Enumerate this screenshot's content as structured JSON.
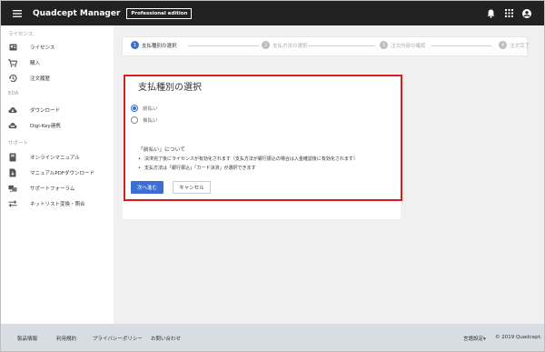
{
  "header": {
    "title": "Quadcept Manager",
    "edition": "Professional edition",
    "icons": [
      "menu-icon",
      "bell-icon",
      "apps-icon",
      "account-icon"
    ]
  },
  "sidebar": {
    "sections": [
      {
        "title": "ライセンス"
      },
      {
        "title": "EDA"
      },
      {
        "title": "サポート"
      }
    ],
    "items": [
      {
        "label": "ライセンス",
        "icon": "license-card-icon"
      },
      {
        "label": "購入",
        "icon": "cart-icon"
      },
      {
        "label": "注文履歴",
        "icon": "history-icon"
      },
      {
        "label": "ダウンロード",
        "icon": "cloud-download-icon"
      },
      {
        "label": "Digi-Key連携",
        "icon": "link-icon"
      },
      {
        "label": "オンラインマニュアル",
        "icon": "book-icon"
      },
      {
        "label": "マニュアルPDFダウンロード",
        "icon": "pdf-download-icon"
      },
      {
        "label": "サポートフォーラム",
        "icon": "forum-icon"
      },
      {
        "label": "ネットリスト変換・照合",
        "icon": "swap-icon"
      }
    ]
  },
  "stepper": {
    "steps": [
      {
        "num": "1",
        "label": "支払種別の選択",
        "active": true
      },
      {
        "num": "2",
        "label": "支払方法の選択",
        "active": false
      },
      {
        "num": "3",
        "label": "注文内容の確認",
        "active": false
      },
      {
        "num": "4",
        "label": "注文完了",
        "active": false
      }
    ]
  },
  "card": {
    "title": "支払種別の選択",
    "options": [
      {
        "label": "前払い",
        "selected": true
      },
      {
        "label": "後払い",
        "selected": false
      }
    ],
    "note_title": "「前払い」について",
    "bullets": [
      "決済完了後にライセンスが有効化されます（支払方法が銀行振込の場合は入金確認後に有効化されます）",
      "支払方法は「銀行振込」「カード決済」が選択できます"
    ],
    "next_label": "次へ進む",
    "cancel_label": "キャンセル"
  },
  "footer": {
    "links": [
      "製品情報",
      "利用規約",
      "プライバシーポリシー",
      "お問い合わせ"
    ],
    "language": "言語設定▾",
    "copyright": "© 2019 Quadcept."
  },
  "colors": {
    "topbar": "#222222",
    "accent": "#3b6fd6",
    "highlight": "#d81b1b",
    "footer": "#d8dde3",
    "main_bg": "#f0f0f0"
  }
}
